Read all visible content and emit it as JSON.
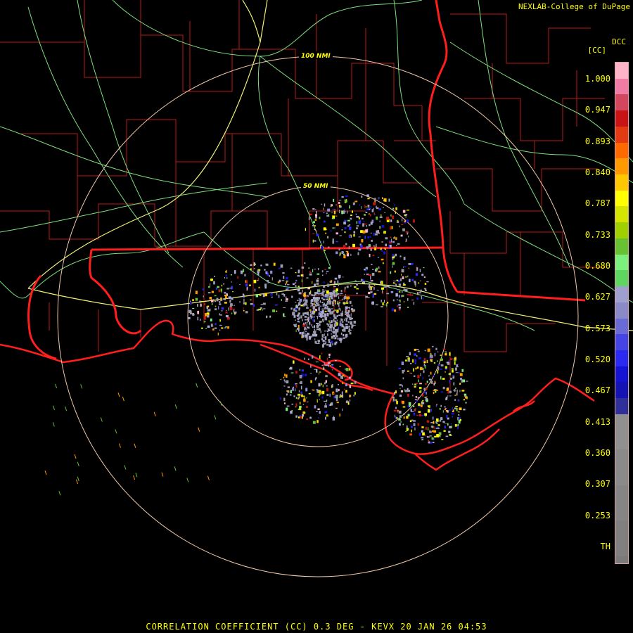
{
  "header": {
    "credit": "NEXLAB-College of DuPage",
    "product_code": "DCC",
    "units": "[CC]"
  },
  "range_rings": [
    "100 NMI",
    "50 NMI"
  ],
  "legend": {
    "ticks": [
      "1.000",
      "0.947",
      "0.893",
      "0.840",
      "0.787",
      "0.733",
      "0.680",
      "0.627",
      "0.573",
      "0.520",
      "0.467",
      "0.413",
      "0.360",
      "0.307",
      "0.253",
      "TH"
    ],
    "colors": [
      "#ffb3c9",
      "#f07ca6",
      "#d2475e",
      "#c81414",
      "#e43a14",
      "#ff6a00",
      "#ff9900",
      "#ffc800",
      "#ffff00",
      "#d4e600",
      "#a0d000",
      "#66c233",
      "#7cf07c",
      "#5fd65f",
      "#a0a0d0",
      "#8a8ac8",
      "#6b6bd8",
      "#4545e6",
      "#2a2af0",
      "#1414d2",
      "#1414b4",
      "#30309a",
      "#909090",
      "#8a8a8a",
      "#858585",
      "#808080",
      "#7b7b7b"
    ]
  },
  "colors": {
    "state_border": "#ff2020",
    "county_lines": "#c81e1e",
    "highways": "#8cf08c",
    "interstates": "#f0f078",
    "range_rings": "#f0c8a8",
    "text": "#ffff00"
  },
  "footer": {
    "text": "CORRELATION COEFFICIENT (CC) 0.3 DEG - KEVX 20 JAN 26 04:53"
  }
}
